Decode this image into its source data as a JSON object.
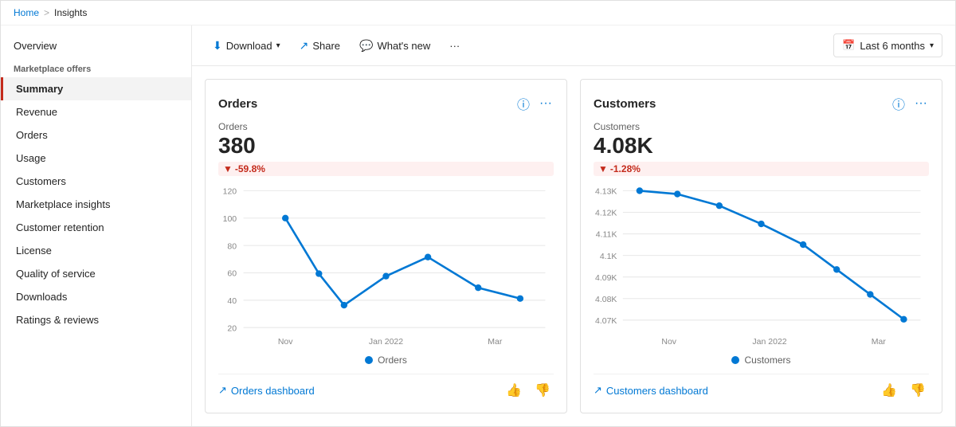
{
  "breadcrumb": {
    "home": "Home",
    "separator": ">",
    "current": "Insights"
  },
  "sidebar": {
    "overview_label": "Overview",
    "section_label": "Marketplace offers",
    "items": [
      {
        "id": "summary",
        "label": "Summary",
        "active": true
      },
      {
        "id": "revenue",
        "label": "Revenue",
        "active": false
      },
      {
        "id": "orders",
        "label": "Orders",
        "active": false
      },
      {
        "id": "usage",
        "label": "Usage",
        "active": false
      },
      {
        "id": "customers",
        "label": "Customers",
        "active": false
      },
      {
        "id": "marketplace-insights",
        "label": "Marketplace insights",
        "active": false
      },
      {
        "id": "customer-retention",
        "label": "Customer retention",
        "active": false
      },
      {
        "id": "license",
        "label": "License",
        "active": false
      },
      {
        "id": "quality-of-service",
        "label": "Quality of service",
        "active": false
      },
      {
        "id": "downloads",
        "label": "Downloads",
        "active": false
      },
      {
        "id": "ratings-reviews",
        "label": "Ratings & reviews",
        "active": false
      }
    ]
  },
  "toolbar": {
    "download_label": "Download",
    "share_label": "Share",
    "whats_new_label": "What's new",
    "more_label": "...",
    "date_range_label": "Last 6 months"
  },
  "orders_card": {
    "title": "Orders",
    "metric_label": "Orders",
    "metric_value": "380",
    "change": "-59.8%",
    "legend": "Orders",
    "dashboard_link": "Orders dashboard",
    "y_labels": [
      "120",
      "100",
      "80",
      "60",
      "40",
      "20"
    ],
    "x_labels": [
      "Nov",
      "Jan 2022",
      "Mar"
    ],
    "data_points": [
      {
        "x": 0.08,
        "y": 0.17
      },
      {
        "x": 0.25,
        "y": 0.52
      },
      {
        "x": 0.38,
        "y": 0.8
      },
      {
        "x": 0.52,
        "y": 0.55
      },
      {
        "x": 0.67,
        "y": 0.4
      },
      {
        "x": 0.82,
        "y": 0.6
      },
      {
        "x": 1.0,
        "y": 0.72
      }
    ]
  },
  "customers_card": {
    "title": "Customers",
    "metric_label": "Customers",
    "metric_value": "4.08K",
    "change": "-1.28%",
    "legend": "Customers",
    "dashboard_link": "Customers dashboard",
    "y_labels": [
      "4.13K",
      "4.12K",
      "4.11K",
      "4.1K",
      "4.09K",
      "4.08K",
      "4.07K"
    ],
    "x_labels": [
      "Nov",
      "Jan 2022",
      "Mar"
    ],
    "data_points": [
      {
        "x": 0.04,
        "y": 0.07
      },
      {
        "x": 0.18,
        "y": 0.09
      },
      {
        "x": 0.32,
        "y": 0.22
      },
      {
        "x": 0.47,
        "y": 0.35
      },
      {
        "x": 0.62,
        "y": 0.48
      },
      {
        "x": 0.75,
        "y": 0.6
      },
      {
        "x": 0.87,
        "y": 0.72
      },
      {
        "x": 1.0,
        "y": 0.9
      }
    ]
  },
  "colors": {
    "accent": "#0078d4",
    "danger": "#c42b1c",
    "chart_line": "#0078d4"
  }
}
